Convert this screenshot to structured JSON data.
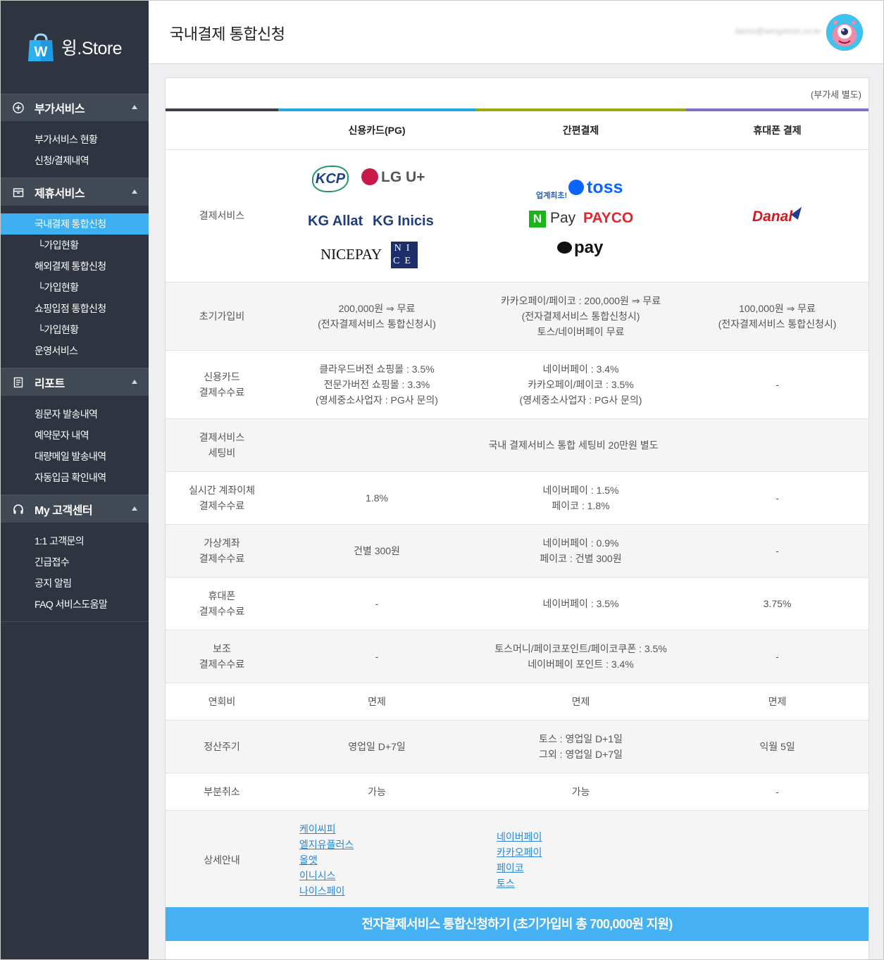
{
  "brand": {
    "name": "윙.Store",
    "bag_letter": "W"
  },
  "sidebar": {
    "sections": [
      {
        "title": "부가서비스",
        "icon": "plus-circle-icon",
        "items": [
          {
            "label": "부가서비스 현황"
          },
          {
            "label": "신청/결제내역"
          }
        ]
      },
      {
        "title": "제휴서비스",
        "icon": "box-icon",
        "items": [
          {
            "label": "국내결제 통합신청"
          },
          {
            "label": "└가입현황"
          },
          {
            "label": "해외결제 통합신청"
          },
          {
            "label": "└가입현황"
          },
          {
            "label": "쇼핑입점 통합신청"
          },
          {
            "label": "└가입현황"
          },
          {
            "label": "운영서비스"
          }
        ]
      },
      {
        "title": "리포트",
        "icon": "report-icon",
        "items": [
          {
            "label": "윙문자 발송내역"
          },
          {
            "label": "예약문자 내역"
          },
          {
            "label": "대량메일 발송내역"
          },
          {
            "label": "자동입금 확인내역"
          }
        ]
      },
      {
        "title": "My 고객센터",
        "icon": "headset-icon",
        "items": [
          {
            "label": "1:1 고객문의"
          },
          {
            "label": "긴급접수"
          },
          {
            "label": "공지 알림"
          },
          {
            "label": "FAQ 서비스도움말"
          }
        ]
      }
    ],
    "active_item": "국내결제 통합신청"
  },
  "header": {
    "title": "국내결제 통합신청",
    "user_email": "damo@wingstore.co.kr"
  },
  "table": {
    "vat_note": "(부가세 별도)",
    "columns": [
      "",
      "신용카드(PG)",
      "간편결제",
      "휴대폰 결제"
    ],
    "accent_colors": [
      "#3a3f48",
      "#27a7e0",
      "#9aa913",
      "#7b74c4"
    ],
    "logos": {
      "pg": [
        "KCP",
        "LG U+",
        "KG Allat",
        "KG Inicis",
        "NICEPAY",
        "NICE"
      ],
      "easy": [
        "업계최초!",
        "toss",
        "N",
        "Pay",
        "PAYCO",
        "pay"
      ],
      "mobile": [
        "Danal"
      ]
    },
    "logo_row_label": "결제서비스",
    "rows": [
      {
        "label": [
          "초기가입비"
        ],
        "pg": [
          "200,000원 ⇒ 무료",
          "(전자결제서비스 통합신청시)"
        ],
        "easy": [
          "카카오페이/페이코 : 200,000원 ⇒ 무료",
          "(전자결제서비스 통합신청시)",
          "토스/네이버페이 무료"
        ],
        "mobile": [
          "100,000원 ⇒ 무료",
          "(전자결제서비스 통합신청시)"
        ]
      },
      {
        "label": [
          "신용카드",
          "결제수수료"
        ],
        "pg": [
          "클라우드버전 쇼핑몰 : 3.5%",
          "전문가버전 쇼핑몰 : 3.3%",
          "(영세중소사업자 : PG사 문의)"
        ],
        "easy": [
          "네이버페이 : 3.4%",
          "카카오페이/페이코 : 3.5%",
          "(영세중소사업자 : PG사 문의)"
        ],
        "mobile": [
          "-"
        ]
      },
      {
        "label": [
          "결제서비스",
          "세팅비"
        ],
        "merged": [
          "국내 결제서비스 통합 세팅비 20만원 별도"
        ]
      },
      {
        "label": [
          "실시간 계좌이체",
          "결제수수료"
        ],
        "pg": [
          "1.8%"
        ],
        "easy": [
          "네이버페이 : 1.5%",
          "페이코 : 1.8%"
        ],
        "mobile": [
          "-"
        ]
      },
      {
        "label": [
          "가상계좌",
          "결제수수료"
        ],
        "pg": [
          "건별 300원"
        ],
        "easy": [
          "네이버페이 : 0.9%",
          "페이코 : 건별 300원"
        ],
        "mobile": [
          "-"
        ]
      },
      {
        "label": [
          "휴대폰",
          "결제수수료"
        ],
        "pg": [
          "-"
        ],
        "easy": [
          "네이버페이 : 3.5%"
        ],
        "mobile": [
          "3.75%"
        ]
      },
      {
        "label": [
          "보조",
          "결제수수료"
        ],
        "pg": [
          "-"
        ],
        "easy": [
          "토스머니/페이코포인트/페이코쿠폰 : 3.5%",
          "네이버페이 포인트 : 3.4%"
        ],
        "mobile": [
          "-"
        ]
      },
      {
        "label": [
          "연회비"
        ],
        "pg": [
          "면제"
        ],
        "easy": [
          "면제"
        ],
        "mobile": [
          "면제"
        ]
      },
      {
        "label": [
          "정산주기"
        ],
        "pg": [
          "영업일 D+7일"
        ],
        "easy": [
          "토스 : 영업일 D+1일",
          "그외 : 영업일 D+7일"
        ],
        "mobile": [
          "익월 5일"
        ]
      },
      {
        "label": [
          "부분취소"
        ],
        "pg": [
          "가능"
        ],
        "easy": [
          "가능"
        ],
        "mobile": [
          "-"
        ]
      }
    ],
    "detail": {
      "label": "상세안내",
      "pg_links": [
        "케이씨피",
        "엘지유플러스",
        "올앳",
        "이니시스",
        "나이스페이"
      ],
      "easy_links": [
        "네이버페이",
        "카카오페이",
        "페이코",
        "토스"
      ]
    }
  },
  "cta": {
    "label": "전자결제서비스 통합신청하기 (초기가입비 총 700,000원 지원)"
  }
}
